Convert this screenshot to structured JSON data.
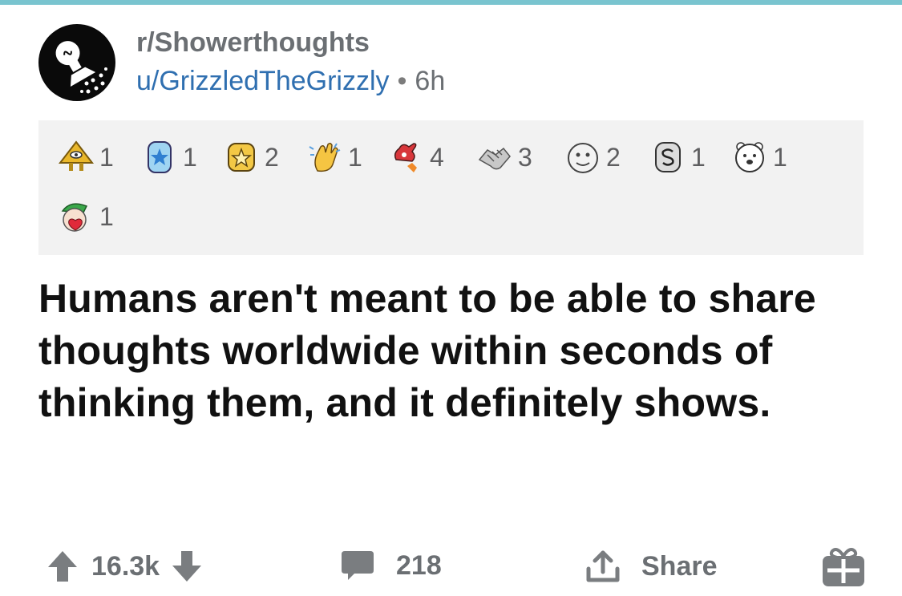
{
  "post": {
    "subreddit": "r/Showerthoughts",
    "author": "u/GrizzledTheGrizzly",
    "separator": "•",
    "age": "6h",
    "title": "Humans aren't meant to be able to share thoughts worldwide within seconds of thinking them, and it definitely shows."
  },
  "awards": [
    {
      "icon": "pyramid-eye-award-icon",
      "count": "1"
    },
    {
      "icon": "blue-star-badge-award-icon",
      "count": "1"
    },
    {
      "icon": "gold-star-badge-award-icon",
      "count": "2"
    },
    {
      "icon": "clapping-hand-award-icon",
      "count": "1"
    },
    {
      "icon": "rocket-like-award-icon",
      "count": "4"
    },
    {
      "icon": "handshake-award-icon",
      "count": "3"
    },
    {
      "icon": "face-award-icon",
      "count": "2"
    },
    {
      "icon": "silver-s-award-icon",
      "count": "1"
    },
    {
      "icon": "bear-award-icon",
      "count": "1"
    },
    {
      "icon": "elf-heart-award-icon",
      "count": "1"
    }
  ],
  "actions": {
    "score": "16.3k",
    "comments": "218",
    "share_label": "Share"
  },
  "colors": {
    "accent_bar": "#79c4cf",
    "username": "#2f6fb0",
    "awards_background": "#f2f2f2",
    "muted_text": "#6b6f73"
  }
}
